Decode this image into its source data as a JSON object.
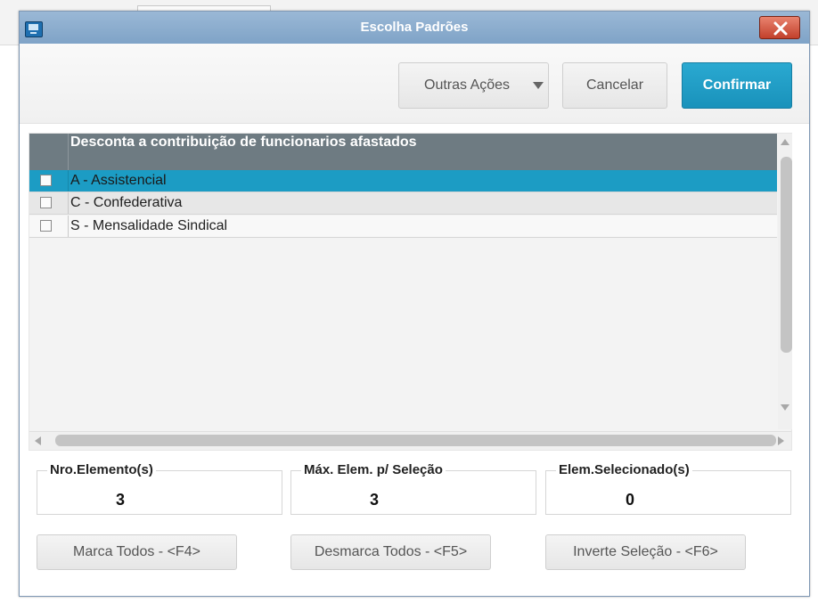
{
  "dialog": {
    "title": "Escolha Padrões"
  },
  "toolbar": {
    "other_actions_label": "Outras Ações",
    "cancel_label": "Cancelar",
    "confirm_label": "Confirmar"
  },
  "grid": {
    "column_header": "Desconta a contribuição de funcionarios afastados",
    "rows": [
      {
        "label": "A - Assistencial",
        "checked": false,
        "selected": true
      },
      {
        "label": "C - Confederativa",
        "checked": false,
        "selected": false
      },
      {
        "label": "S - Mensalidade Sindical",
        "checked": false,
        "selected": false
      }
    ]
  },
  "counters": {
    "total_label": "Nro.Elemento(s)",
    "total_value": "3",
    "max_label": "Máx. Elem. p/ Seleção",
    "max_value": "3",
    "selected_label": "Elem.Selecionado(s)",
    "selected_value": "0"
  },
  "actions": {
    "mark_all_label": "Marca Todos - <F4>",
    "unmark_all_label": "Desmarca Todos - <F5>",
    "invert_label": "Inverte Seleção - <F6>"
  },
  "colors": {
    "accent": "#1c9cc4",
    "header": "#6e7b82",
    "titlebar": "#8aabcc",
    "close": "#c2402b"
  }
}
